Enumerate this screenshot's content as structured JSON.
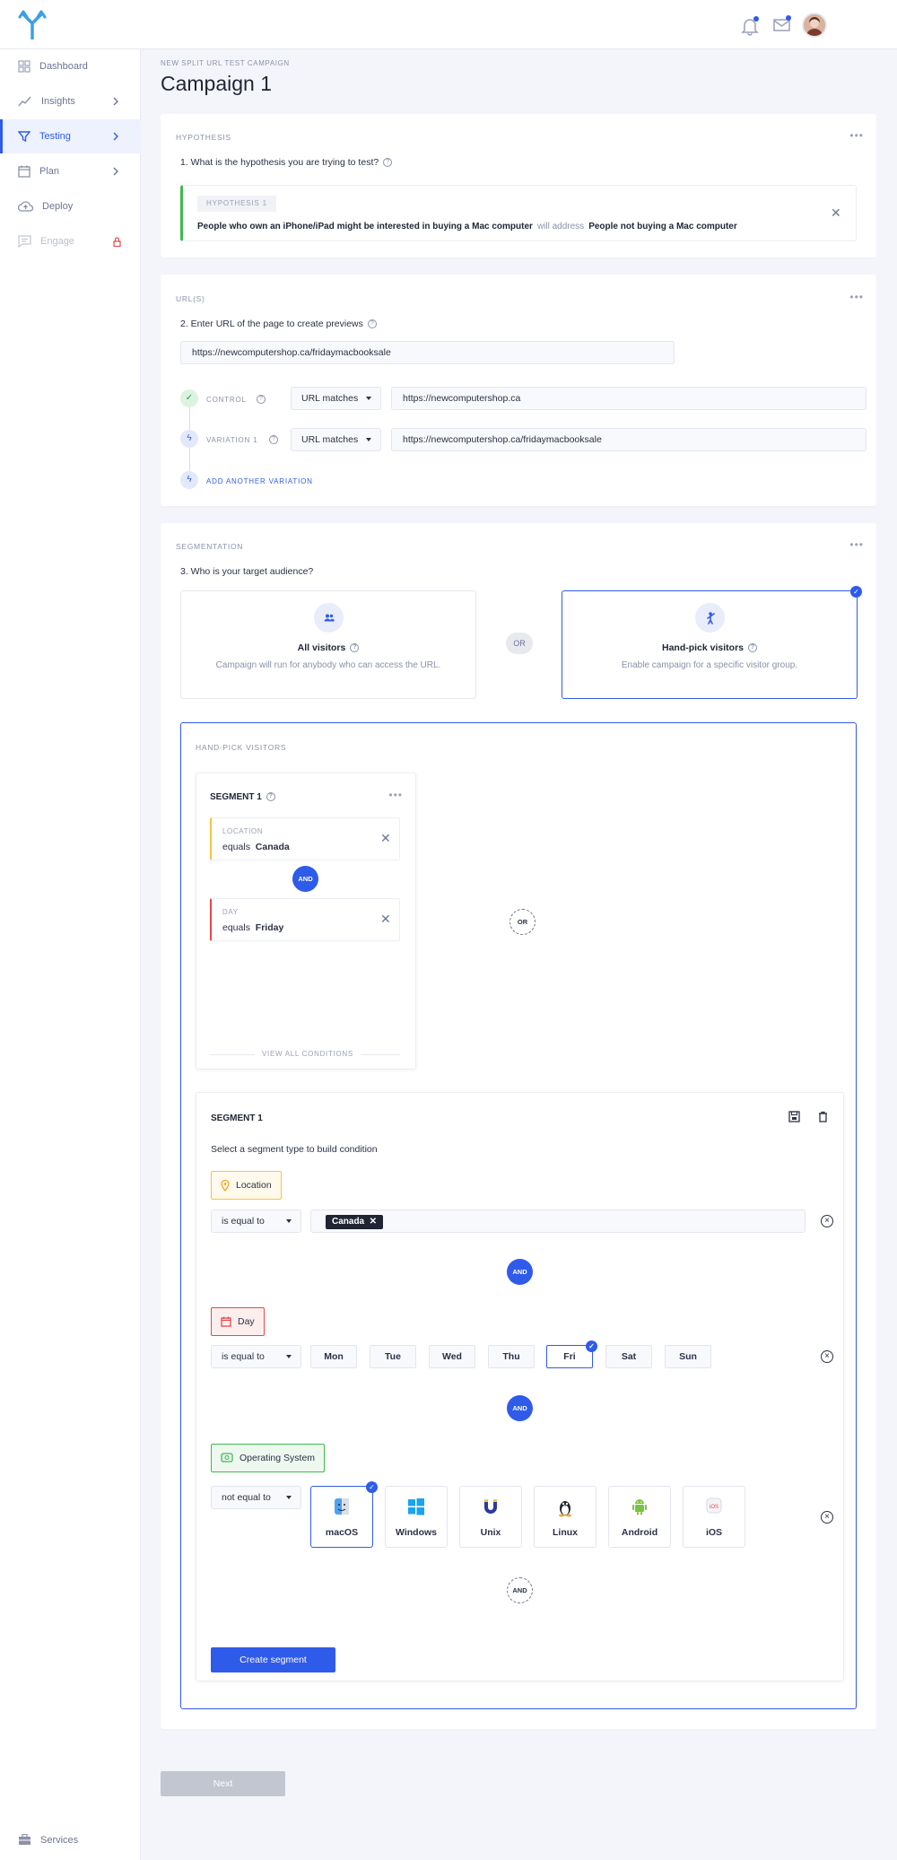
{
  "nav": {
    "items": [
      {
        "label": "Dashboard"
      },
      {
        "label": "Insights"
      },
      {
        "label": "Testing"
      },
      {
        "label": "Plan"
      },
      {
        "label": "Deploy"
      },
      {
        "label": "Engage"
      }
    ],
    "services": "Services"
  },
  "page": {
    "breadcrumb": "NEW SPLIT URL TEST CAMPAIGN",
    "title": "Campaign 1"
  },
  "hypothesis": {
    "section_label": "HYPOTHESIS",
    "question": "1. What is the hypothesis you are trying to test?",
    "tag": "HYPOTHESIS 1",
    "subject": "People who own an iPhone/iPad might be interested in buying a Mac computer",
    "connector": "will address",
    "object": "People not buying a Mac computer"
  },
  "urls": {
    "section_label": "URL(S)",
    "question": "2. Enter URL of the page to create previews",
    "preview_url": "https://newcomputershop.ca/fridaymacbooksale",
    "control": {
      "label": "CONTROL",
      "match": "URL matches",
      "url": "https://newcomputershop.ca"
    },
    "variation": {
      "label": "VARIATION 1",
      "match": "URL matches",
      "url": "https://newcomputershop.ca/fridaymacbooksale"
    },
    "add_variation": "ADD ANOTHER VARIATION"
  },
  "segmentation": {
    "section_label": "SEGMENTATION",
    "question": "3. Who is your target audience?",
    "all_visitors": {
      "title": "All visitors",
      "sub": "Campaign will run for anybody who can access the URL."
    },
    "or": "OR",
    "hand_pick": {
      "title": "Hand-pick visitors",
      "sub": "Enable campaign for a specific visitor group."
    }
  },
  "handpick": {
    "label": "HAND-PICK VISITORS",
    "segment_title": "SEGMENT 1",
    "conditions": [
      {
        "label": "LOCATION",
        "op": "equals",
        "value": "Canada",
        "color": "#f5c542"
      },
      {
        "label": "DAY",
        "op": "equals",
        "value": "Friday",
        "color": "#e5484d"
      }
    ],
    "and": "AND",
    "or": "OR",
    "view_all": "VIEW ALL CONDITIONS"
  },
  "builder": {
    "title": "SEGMENT 1",
    "instruction": "Select a segment type to build condition",
    "location": {
      "tag": "Location",
      "op": "is equal to",
      "chip": "Canada"
    },
    "day": {
      "tag": "Day",
      "op": "is equal to",
      "options": [
        "Mon",
        "Tue",
        "Wed",
        "Thu",
        "Fri",
        "Sat",
        "Sun"
      ],
      "selected": "Fri"
    },
    "os": {
      "tag": "Operating System",
      "op": "not equal to",
      "options": [
        "macOS",
        "Windows",
        "Unix",
        "Linux",
        "Android",
        "iOS"
      ],
      "selected": "macOS"
    },
    "and": "AND",
    "create": "Create segment"
  },
  "footer": {
    "next": "Next"
  },
  "colors": {
    "accent": "#2f5bea",
    "success": "#3fb950",
    "warning": "#f5c542",
    "danger": "#e5484d"
  }
}
